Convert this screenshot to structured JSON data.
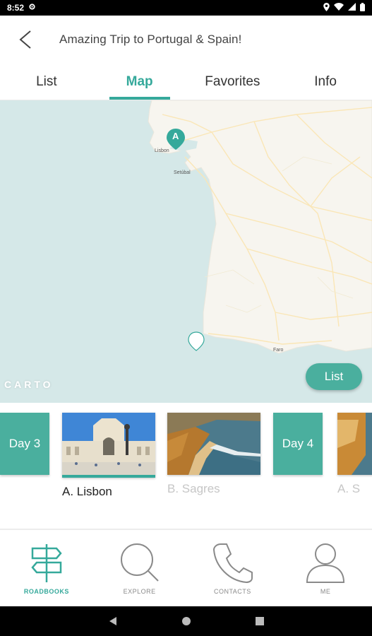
{
  "status_bar": {
    "time": "8:52"
  },
  "header": {
    "title": "Amazing Trip to Portugal & Spain!"
  },
  "tabs": [
    {
      "label": "List",
      "active": false
    },
    {
      "label": "Map",
      "active": true
    },
    {
      "label": "Favorites",
      "active": false
    },
    {
      "label": "Info",
      "active": false
    }
  ],
  "map": {
    "labels": {
      "lisbon": "Lisbon",
      "setubal": "Setúbal",
      "faro": "Faro"
    },
    "markers": {
      "a": "A"
    },
    "attribution": "CARTO",
    "list_button": "List",
    "colors": {
      "sea": "#d5e8e8",
      "land": "#f7f5ef",
      "roads": "#fae6b6",
      "marker": "#35a99b"
    }
  },
  "carousel": {
    "day_cards": [
      {
        "label": "Day 3"
      },
      {
        "label": "Day 4"
      }
    ],
    "places": [
      {
        "name": "A. Lisbon",
        "selected": true
      },
      {
        "name": "B. Sagres",
        "selected": false
      },
      {
        "name": "A. S",
        "selected": false
      }
    ]
  },
  "bottom_nav": [
    {
      "label": "ROADBOOKS",
      "icon": "signpost-icon",
      "active": true
    },
    {
      "label": "EXPLORE",
      "icon": "search-icon",
      "active": false
    },
    {
      "label": "CONTACTS",
      "icon": "phone-icon",
      "active": false
    },
    {
      "label": "ME",
      "icon": "person-icon",
      "active": false
    }
  ],
  "accent_color": "#35a99b"
}
